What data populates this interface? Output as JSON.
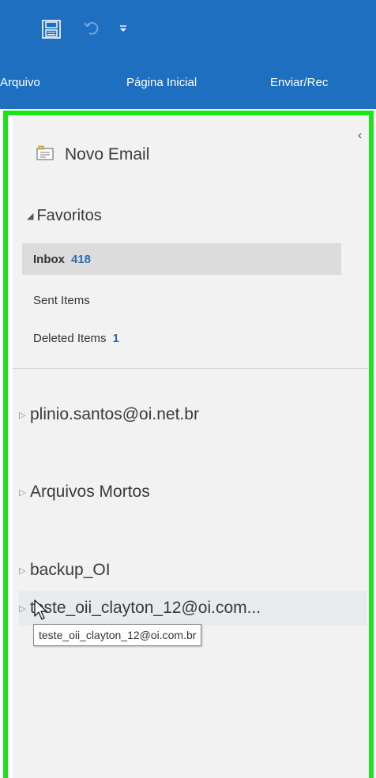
{
  "quick_access": {
    "save_icon": "save-icon",
    "undo_icon": "undo-icon",
    "customize_icon": "customize-quick-access-icon"
  },
  "ribbon": {
    "tabs": [
      {
        "label": "Arquivo"
      },
      {
        "label": "Página Inicial"
      },
      {
        "label": "Enviar/Rec"
      }
    ]
  },
  "folder_pane": {
    "collapse_glyph": "‹",
    "new_email_label": "Novo Email",
    "favorites": {
      "label": "Favoritos",
      "expand_glyph": "◢",
      "items": [
        {
          "label": "Inbox",
          "count": "418",
          "selected": true
        },
        {
          "label": "Sent Items",
          "count": ""
        },
        {
          "label": "Deleted Items",
          "count": "1"
        }
      ]
    },
    "accounts": [
      {
        "label": "plinio.santos@oi.net.br"
      },
      {
        "label": "Arquivos Mortos"
      },
      {
        "label": "backup_OI"
      },
      {
        "label": "teste_oii_clayton_12@oi.com..."
      }
    ],
    "tooltip": "teste_oii_clayton_12@oi.com.br"
  },
  "colors": {
    "title_bar": "#1e6fc0",
    "highlight_border": "#19e519",
    "count_accent": "#2a6cb5"
  }
}
